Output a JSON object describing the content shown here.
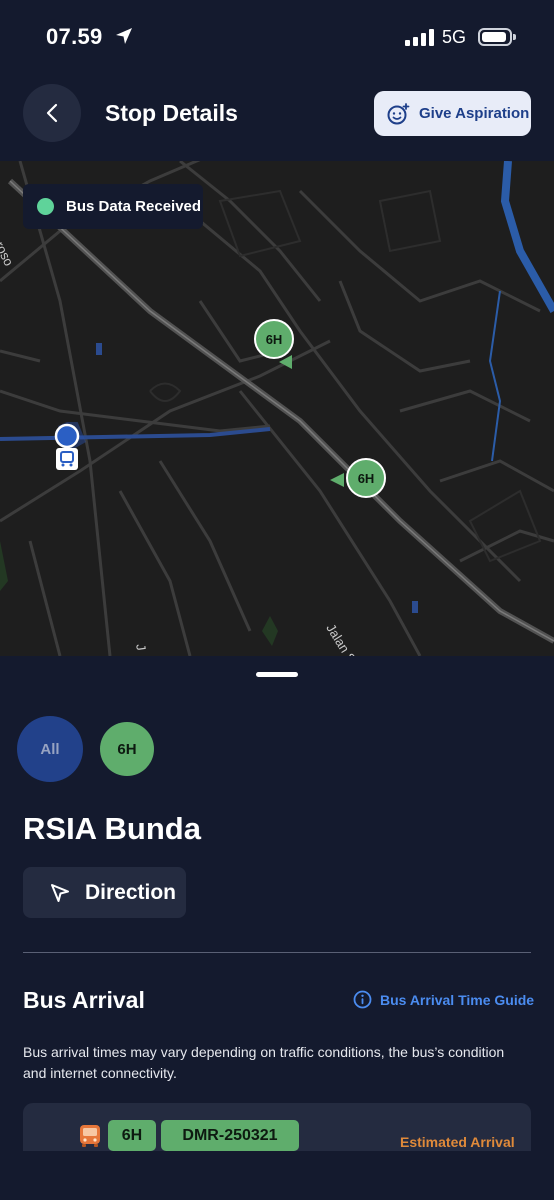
{
  "status_bar": {
    "time": "07.59",
    "network": "5G",
    "icons": [
      "location-arrow-icon",
      "signal-icon",
      "battery-icon"
    ]
  },
  "header": {
    "title": "Stop Details",
    "back_icon": "chevron-left-icon",
    "aspiration_label": "Give Aspiration",
    "aspiration_icon": "smile-sparkle-icon"
  },
  "map": {
    "legend_label": "Bus Data Received",
    "legend_color": "#5fd39a",
    "markers": [
      {
        "route": "6H"
      },
      {
        "route": "6H"
      }
    ],
    "street_labels": [
      "RP Soeroso",
      "Jalan S",
      "J"
    ]
  },
  "filters": {
    "all_label": "All",
    "route_label": "6H"
  },
  "stop": {
    "name": "RSIA Bunda",
    "direction_label": "Direction",
    "direction_icon": "navigation-arrow-icon"
  },
  "bus_arrival": {
    "title": "Bus Arrival",
    "guide_label": "Bus Arrival Time Guide",
    "guide_icon": "info-icon",
    "disclaimer": "Bus arrival times may vary depending on traffic conditions, the bus’s condition and internet connectivity.",
    "items": [
      {
        "route": "6H",
        "plate": "DMR-250321",
        "status_label": "Estimated Arrival",
        "icon": "bus-icon"
      }
    ]
  },
  "colors": {
    "background": "#141a2e",
    "route_green": "#5fad6c",
    "accent_blue": "#4b8cf0",
    "estimate_orange": "#e08a3a",
    "filter_all_blue": "#22418a"
  }
}
